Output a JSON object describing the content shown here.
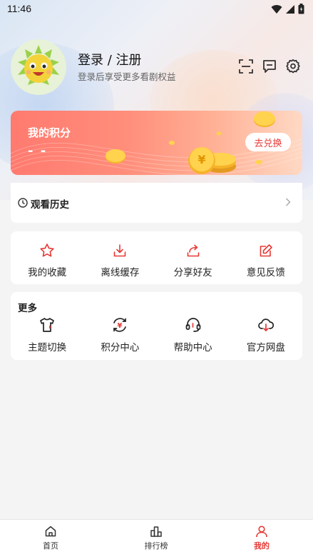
{
  "status_bar": {
    "time": "11:46"
  },
  "profile": {
    "login_title": "登录 / 注册",
    "login_subtitle": "登录后享受更多看剧权益"
  },
  "header_icons": [
    "scan-icon",
    "message-icon",
    "settings-icon"
  ],
  "points": {
    "title": "我的积分",
    "value": "- -",
    "redeem_label": "去兑换"
  },
  "history": {
    "label": "观看历史"
  },
  "quick_actions": [
    {
      "label": "我的收藏",
      "icon": "star-icon"
    },
    {
      "label": "离线缓存",
      "icon": "download-icon"
    },
    {
      "label": "分享好友",
      "icon": "share-icon"
    },
    {
      "label": "意见反馈",
      "icon": "feedback-icon"
    }
  ],
  "more": {
    "title": "更多",
    "items": [
      {
        "label": "主题切换",
        "icon": "shirt-icon"
      },
      {
        "label": "积分中心",
        "icon": "points-center-icon"
      },
      {
        "label": "帮助中心",
        "icon": "headset-icon"
      },
      {
        "label": "官方网盘",
        "icon": "cloud-download-icon"
      }
    ]
  },
  "tabbar": [
    {
      "label": "首页",
      "icon": "home-icon"
    },
    {
      "label": "排行榜",
      "icon": "ranking-icon"
    },
    {
      "label": "我的",
      "icon": "user-icon",
      "active": true
    }
  ],
  "colors": {
    "accent": "#e53935",
    "points_gradient_start": "#ff7a6f",
    "points_gradient_end": "#ffd9c4"
  }
}
